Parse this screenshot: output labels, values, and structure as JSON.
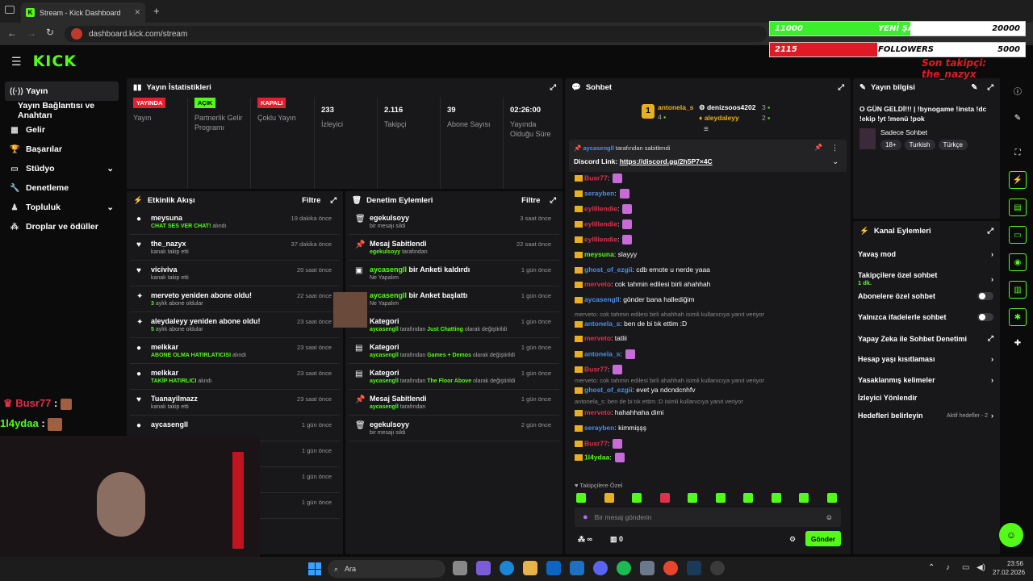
{
  "browser": {
    "tab_title": "Stream - Kick Dashboard",
    "url": "dashboard.kick.com/stream"
  },
  "sidebar": {
    "items": [
      {
        "label": "Yayın",
        "icon": "broadcast-icon"
      },
      {
        "label": "Yayın Bağlantısı ve Anahtarı",
        "icon": ""
      },
      {
        "label": "Gelir",
        "icon": "wallet-icon"
      },
      {
        "label": "Başarılar",
        "icon": "trophy-icon"
      },
      {
        "label": "Stüdyo",
        "icon": "studio-icon"
      },
      {
        "label": "Denetleme",
        "icon": "wrench-icon"
      },
      {
        "label": "Topluluk",
        "icon": "community-icon"
      },
      {
        "label": "Droplar ve ödüller",
        "icon": "gift-icon"
      }
    ]
  },
  "stats": {
    "title": "Yayın İstatistikleri",
    "items": [
      {
        "badge": "YAYINDA",
        "label": "Yayın",
        "badge_color": "#e5202d"
      },
      {
        "badge": "AÇIK",
        "label": "Partnerlik Gelir Programı",
        "badge_color": "#53fc18"
      },
      {
        "badge": "KAPALI",
        "label": "Çoklu Yayın",
        "badge_color": "#e5202d"
      },
      {
        "value": "233",
        "label": "İzleyici"
      },
      {
        "value": "2.116",
        "label": "Takipçi"
      },
      {
        "value": "39",
        "label": "Abone Sayısı"
      },
      {
        "value": "02:26:00",
        "label": "Yayında Olduğu Süre"
      }
    ]
  },
  "activity": {
    "title": "Etkinlik Akışı",
    "filter": "Filtre",
    "rows": [
      {
        "name": "meysuna",
        "sub_green": "CHAT SES VER CHAT!",
        "sub": " alındı",
        "time": "19 dakika önce"
      },
      {
        "name": "the_nazyx",
        "sub": "kanalı takip etti",
        "time": "37 dakika önce"
      },
      {
        "name": "viciviva",
        "sub": "kanalı takip etti",
        "time": "20 saat önce"
      },
      {
        "name": "merveto yeniden abone oldu!",
        "sub_green": "3",
        "sub": " aylık abone oldular",
        "time": "22 saat önce"
      },
      {
        "name": "aleydaleyy yeniden abone oldu!",
        "sub_green": "5",
        "sub": " aylık abone oldular",
        "time": "23 saat önce"
      },
      {
        "name": "melkkar",
        "sub_green": "ABONE OLMA HATIRLATICISI",
        "sub": " alındı",
        "time": "23 saat önce"
      },
      {
        "name": "melkkar",
        "sub_green": "TAKİP HATIRLICI",
        "sub": " alındı",
        "time": "23 saat önce"
      },
      {
        "name": "Tuanayilmazz",
        "sub": "kanalı takip etti",
        "time": "23 saat önce"
      },
      {
        "name": "aycasengll",
        "sub": "",
        "time": "1 gün önce"
      },
      {
        "name": "",
        "sub": "",
        "time": "1 gün önce"
      },
      {
        "name": "",
        "sub": "",
        "time": "1 gün önce"
      },
      {
        "name": "",
        "sub": "",
        "time": "1 gün önce"
      }
    ]
  },
  "moderation": {
    "title": "Denetim Eylemleri",
    "filter": "Filtre",
    "rows": [
      {
        "name": "egekulsoyy",
        "sub": "bir mesajı sildi",
        "time": "3 saat önce"
      },
      {
        "name": "Mesaj Sabitlendi",
        "sub_green": "egekulsoyy",
        "sub": " tarafından",
        "time": "22 saat önce"
      },
      {
        "name_green": "aycasengll",
        "name": " bir Anketi kaldırdı",
        "sub": "Ne Yapalım",
        "time": "1 gün önce"
      },
      {
        "name_green": "aycasengll",
        "name": " bir Anket başlattı",
        "sub": "Ne Yapalım",
        "time": "1 gün önce"
      },
      {
        "name": "Kategori",
        "sub_green": "aycasengll",
        "sub": " tarafından ",
        "sub_green2": "Just Chatting",
        "sub2": " olarak değiştirildi",
        "time": "1 gün önce"
      },
      {
        "name": "Kategori",
        "sub_green": "aycasengll",
        "sub": " tarafından ",
        "sub_green2": "Games + Demos",
        "sub2": " olarak değiştirildi",
        "time": "1 gün önce"
      },
      {
        "name": "Kategori",
        "sub_green": "aycasengll",
        "sub": " tarafından ",
        "sub_green2": "The Floor Above",
        "sub2": " olarak değiştirildi",
        "time": "1 gün önce"
      },
      {
        "name": "Mesaj Sabitlendi",
        "sub_green": "aycasengll",
        "sub": " tarafından",
        "time": "1 gün önce"
      },
      {
        "name": "egekulsoyy",
        "sub": "bir mesajı sildi",
        "time": "2 gün önce"
      }
    ]
  },
  "chat": {
    "title": "Sohbet",
    "top": [
      {
        "name": "antonela_s",
        "count": "4"
      },
      {
        "name": "denizsoos4202",
        "count": "3"
      },
      {
        "name": "aleydaleyy",
        "count": "2"
      }
    ],
    "pinned": {
      "by": "aycasengll",
      "by_suffix": " tarafından sabitlendi",
      "text": "Discord Link: ",
      "link": "https://discord.gg/2h5P7×4C"
    },
    "messages": [
      {
        "user": "Busr77",
        "color": "#e0304a",
        "text": ":"
      },
      {
        "user": "serayben",
        "color": "#4b8de8",
        "text": ":"
      },
      {
        "user": "eyllllendie",
        "color": "#e0304a",
        "text": ":"
      },
      {
        "user": "eyllllendie",
        "color": "#e0304a",
        "text": ":"
      },
      {
        "user": "eyllllendie",
        "color": "#e0304a",
        "text": ":"
      },
      {
        "user": "meysuna",
        "color": "#53fc18",
        "text": ": slayyy"
      },
      {
        "user": "ghost_of_ezgii",
        "color": "#4b8de8",
        "text": ": cdb emote u nerde yaaa"
      },
      {
        "user": "merveto",
        "color": "#e0304a",
        "text": ": cok tahmin edilesi birli ahahhah"
      },
      {
        "user": "aycasengll",
        "color": "#4b8de8",
        "text": ": gönder bana hallediğim"
      },
      {
        "reply": "merveto: cok tahmin edilesi birli ahahhah isimli kullanıcıya yanıt veriyor"
      },
      {
        "user": "antonela_s",
        "color": "#4b8de8",
        "text": ": ben de bi tık ettim :D"
      },
      {
        "user": "merveto",
        "color": "#e0304a",
        "text": ": tatlii"
      },
      {
        "user": "antonela_s",
        "color": "#4b8de8",
        "text": ":"
      },
      {
        "user": "Busr77",
        "color": "#e0304a",
        "text": ":"
      },
      {
        "reply": "merveto: cok tahmin edilesi birli ahahhah isimli kullanıcıya yanıt veriyor"
      },
      {
        "user": "ghost_of_ezgii",
        "color": "#4b8de8",
        "text": ": evet ya ndcndcnhfv"
      },
      {
        "reply": "antonela_s: ben de bi tık ettim :D isimli kullanıcıya yanıt veriyor"
      },
      {
        "user": "merveto",
        "color": "#e0304a",
        "text": ": hahahhaha dimi"
      },
      {
        "user": "serayben",
        "color": "#4b8de8",
        "text": ": kimmişşş"
      },
      {
        "user": "Busr77",
        "color": "#e0304a",
        "text": ":"
      },
      {
        "user": "1l4ydaa",
        "color": "#53fc18",
        "text": ":"
      }
    ],
    "followers_only": "Takipçilere Özel",
    "input_placeholder": "Bir mesaj gönderin",
    "send": "Gönder",
    "count": "0"
  },
  "stream_info": {
    "title": "Yayın bilgisi",
    "desc": "O GÜN GELDİ!!! | !bynogame !insta !dc !ekip !yt !menü !pok",
    "category": "Sadece Sohbet",
    "tags": [
      "18+",
      "Turkish",
      "Türkçe"
    ]
  },
  "channel_actions": {
    "title": "Kanal Eylemleri",
    "items": [
      {
        "label": "Yavaş mod",
        "type": "arrow"
      },
      {
        "label": "Takipçilere özel sohbet",
        "sub": "1 dk.",
        "type": "arrow"
      },
      {
        "label": "Abonelere özel sohbet",
        "type": "toggle"
      },
      {
        "label": "Yalnızca ifadelerle sohbet",
        "type": "toggle"
      },
      {
        "label": "Yapay Zeka ile Sohbet Denetimi",
        "type": "external"
      },
      {
        "label": "Hesap yaşı kısıtlaması",
        "type": "arrow"
      },
      {
        "label": "Yasaklanmış kelimeler",
        "type": "arrow"
      },
      {
        "label": "İzleyici Yönlendir",
        "type": "none"
      },
      {
        "label": "Hedefleri belirleyin",
        "note": "Aktif hedefler - 2",
        "type": "arrow"
      }
    ]
  },
  "overlay": {
    "goal1_left": "11000",
    "goal1_mid": "YENİ ŞARKI",
    "goal1_right": "20000",
    "goal1_progress": 0.55,
    "goal2_left": "2115",
    "goal2_mid": "FOLLOWERS",
    "goal2_right": "5000",
    "goal2_progress": 0.42,
    "last_follower": "Son takipçi: the_nazyx",
    "cam_chat": [
      {
        "user": "Busr77",
        "text": ":"
      },
      {
        "user": "1l4ydaa",
        "text": ":"
      }
    ]
  },
  "taskbar": {
    "search": "Ara",
    "time": "23:56",
    "date": "27.02.2026"
  }
}
